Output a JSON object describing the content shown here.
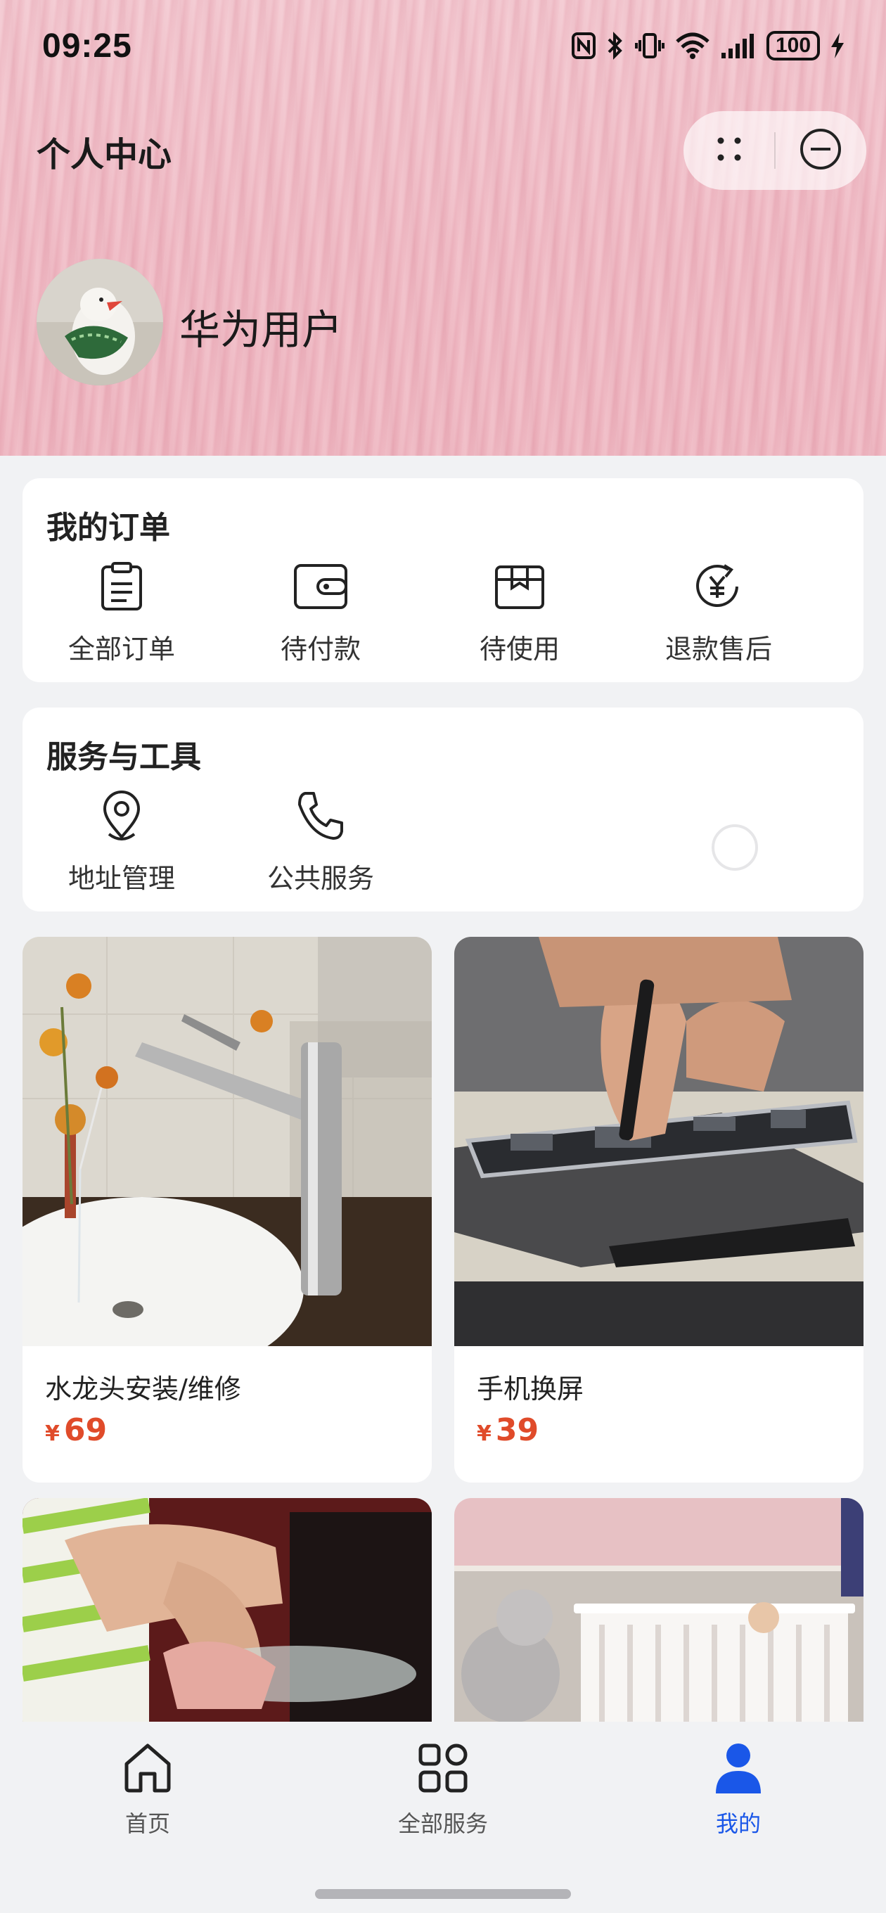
{
  "status_bar": {
    "time": "09:25",
    "battery": "100",
    "icons": [
      "nfc-icon",
      "bluetooth-icon",
      "vibrate-icon",
      "wifi-icon",
      "signal-icon",
      "battery-icon",
      "charging-icon"
    ]
  },
  "header": {
    "title": "个人中心",
    "capsule": {
      "more_icon": "more-dots-icon",
      "close_icon": "minus-circle-icon"
    },
    "user": {
      "name": "华为用户"
    }
  },
  "orders": {
    "title": "我的订单",
    "items": [
      {
        "label": "全部订单",
        "icon": "clipboard-icon"
      },
      {
        "label": "待付款",
        "icon": "wallet-icon"
      },
      {
        "label": "待使用",
        "icon": "package-icon"
      },
      {
        "label": "退款售后",
        "icon": "refund-icon"
      }
    ]
  },
  "services": {
    "title": "服务与工具",
    "items": [
      {
        "label": "地址管理",
        "icon": "location-pin-icon"
      },
      {
        "label": "公共服务",
        "icon": "phone-icon"
      }
    ]
  },
  "products": [
    {
      "name": "水龙头安装/维修",
      "currency": "¥",
      "price": "69"
    },
    {
      "name": "手机换屏",
      "currency": "¥",
      "price": "39"
    },
    {
      "name": "",
      "currency": "",
      "price": ""
    },
    {
      "name": "",
      "currency": "",
      "price": ""
    }
  ],
  "bottom_nav": {
    "items": [
      {
        "label": "首页",
        "icon": "home-icon",
        "active": false
      },
      {
        "label": "全部服务",
        "icon": "grid-icon",
        "active": false
      },
      {
        "label": "我的",
        "icon": "user-icon",
        "active": true
      }
    ]
  },
  "colors": {
    "accent": "#1a57e8",
    "price": "#e04b2a",
    "header_bg": "#f0bcc6",
    "page_bg": "#f1f2f4"
  }
}
